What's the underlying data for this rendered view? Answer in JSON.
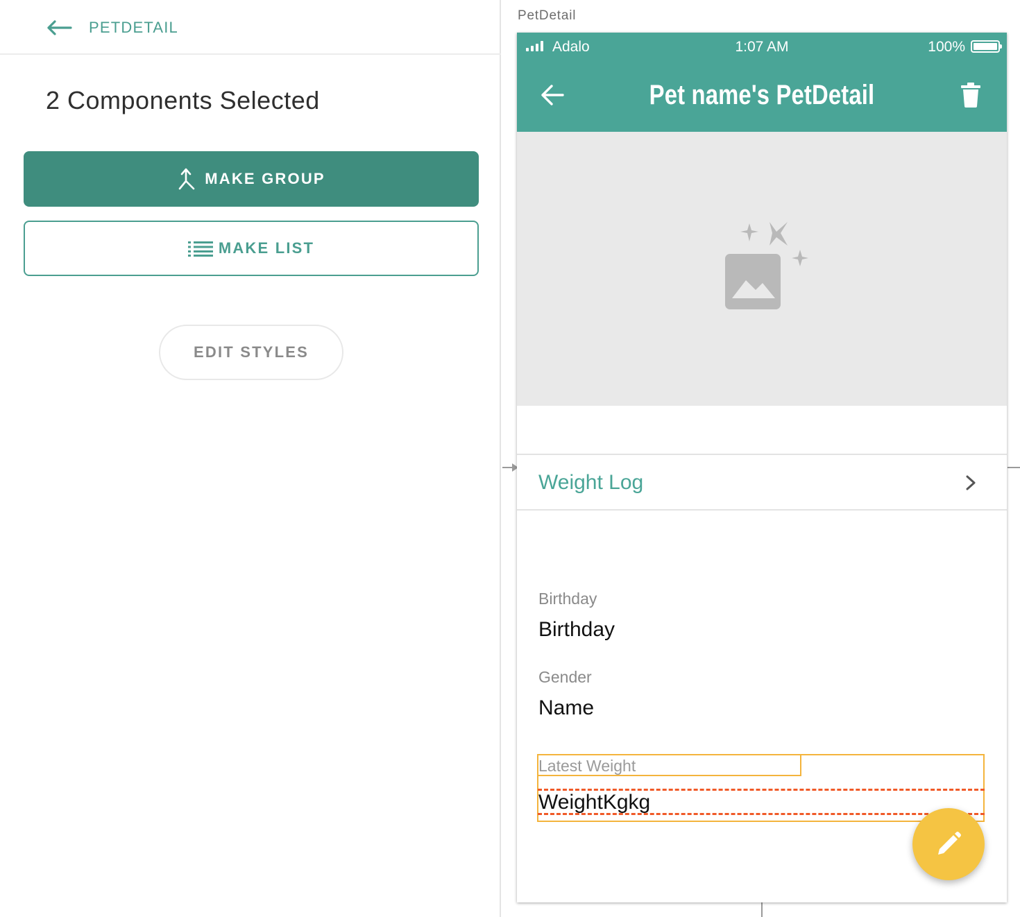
{
  "left_panel": {
    "back_label": "PETDETAIL",
    "selection_title": "2 Components Selected",
    "make_group_label": "MAKE GROUP",
    "make_list_label": "MAKE LIST",
    "edit_styles_label": "EDIT STYLES"
  },
  "canvas": {
    "screen_name": "PetDetail"
  },
  "phone": {
    "status": {
      "carrier": "Adalo",
      "time": "1:07 AM",
      "battery": "100%"
    },
    "app_bar": {
      "title": "Pet name's PetDetail",
      "left_icon": "arrow-left-icon",
      "right_icon": "trash-icon"
    },
    "image_placeholder_icon": "image-sparkle-icon",
    "list_row": {
      "label": "Weight Log",
      "icon": "chevron-right-icon"
    },
    "fields": [
      {
        "label": "Birthday",
        "value": "Birthday"
      },
      {
        "label": "Gender",
        "value": "Name"
      },
      {
        "label": "Latest Weight",
        "value": "WeightKgkg"
      }
    ],
    "fab_icon": "pencil-icon"
  },
  "colors": {
    "brand_teal": "#4aa597",
    "button_teal": "#3f8d7e",
    "fab_yellow": "#f5c443",
    "selection_orange": "#f4b43c",
    "selection_dash_red": "#f05a28"
  }
}
